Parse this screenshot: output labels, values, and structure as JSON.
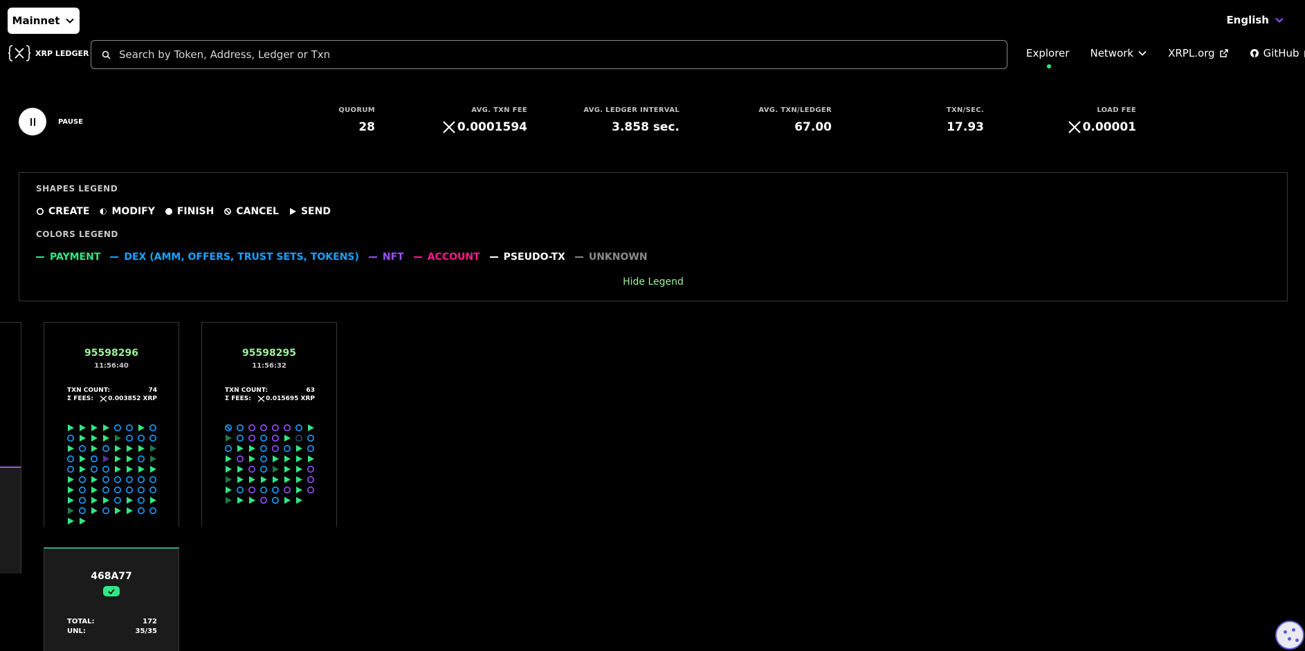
{
  "header": {
    "network_label": "Mainnet",
    "language_label": "English",
    "logo_text": "XRP LEDGER",
    "search_placeholder": "Search by Token, Address, Ledger or Txn",
    "nav": [
      {
        "label": "Explorer"
      },
      {
        "label": "Network"
      },
      {
        "label": "XRPL.org"
      },
      {
        "label": "GitHub"
      }
    ]
  },
  "metrics": {
    "pause_label": "PAUSE",
    "items": [
      {
        "label": "QUORUM",
        "value": "28"
      },
      {
        "label": "AVG. TXN FEE",
        "value": "0.0001594"
      },
      {
        "label": "AVG. LEDGER INTERVAL",
        "value": "3.858 sec."
      },
      {
        "label": "AVG. TXN/LEDGER",
        "value": "67.00"
      },
      {
        "label": "TXN/SEC.",
        "value": "17.93"
      },
      {
        "label": "LOAD FEE",
        "value": "0.00001"
      }
    ]
  },
  "legend": {
    "shapes_title": "SHAPES LEGEND",
    "shapes": [
      "CREATE",
      "MODIFY",
      "FINISH",
      "CANCEL",
      "SEND"
    ],
    "colors_title": "COLORS LEGEND",
    "colors": [
      {
        "label": "PAYMENT",
        "color": "#32e685"
      },
      {
        "label": "DEX (AMM, OFFERS, TRUST SETS, TOKENS)",
        "color": "#19a3ff"
      },
      {
        "label": "NFT",
        "color": "#9a52ff"
      },
      {
        "label": "ACCOUNT",
        "color": "#ff198b"
      },
      {
        "label": "PSEUDO-TX",
        "color": "#ffffff"
      },
      {
        "label": "UNKNOWN",
        "color": "#8a8a8a"
      }
    ],
    "hide_label": "Hide Legend"
  },
  "ledgers": [
    {
      "index": "95598296",
      "time": "11:56:40",
      "txn_count_label": "TXN COUNT:",
      "txn_count": "74",
      "fees_label": "Σ FEES:",
      "fees": "0.003852 XRP",
      "grid": [
        "PsPsPsPsDoDoPsDo",
        "DoPsPsPsPfDoDoDo",
        "PsDoPsDoPsPsPsPf",
        "DoPsDoNfPsPsDoPf",
        "DoPsDoDoPsPsPsPs",
        "PsDoPsDoDoDoDoDo",
        "PsDoPsDoDoDoDoDo",
        "PsDoPsPsDoPsDoPs",
        "PfDoPsDoPsPsDoDo",
        "PsPs"
      ]
    },
    {
      "index": "95598295",
      "time": "11:56:32",
      "txn_count_label": "TXN COUNT:",
      "txn_count": "63",
      "fees_label": "Σ FEES:",
      "fees": "0.015695 XRP",
      "grid": [
        "DxDoNoNoNoNoDoPs",
        "PfDoNoDoNoPsDdDo",
        "DoPsPsDoNoDoPsDo",
        "PsNoPsDoPsPsPsPs",
        "PsPsNoDoPfPsPsNo",
        "PfPsPsPsPsPsPsNo",
        "PsDoNoDoDoNoPsNo",
        "PfPsPsNoDoPsPs"
      ]
    }
  ],
  "validation": {
    "hash": "468A77",
    "total_label": "TOTAL:",
    "total": "172",
    "unl_label": "UNL:",
    "unl": "35/35"
  }
}
